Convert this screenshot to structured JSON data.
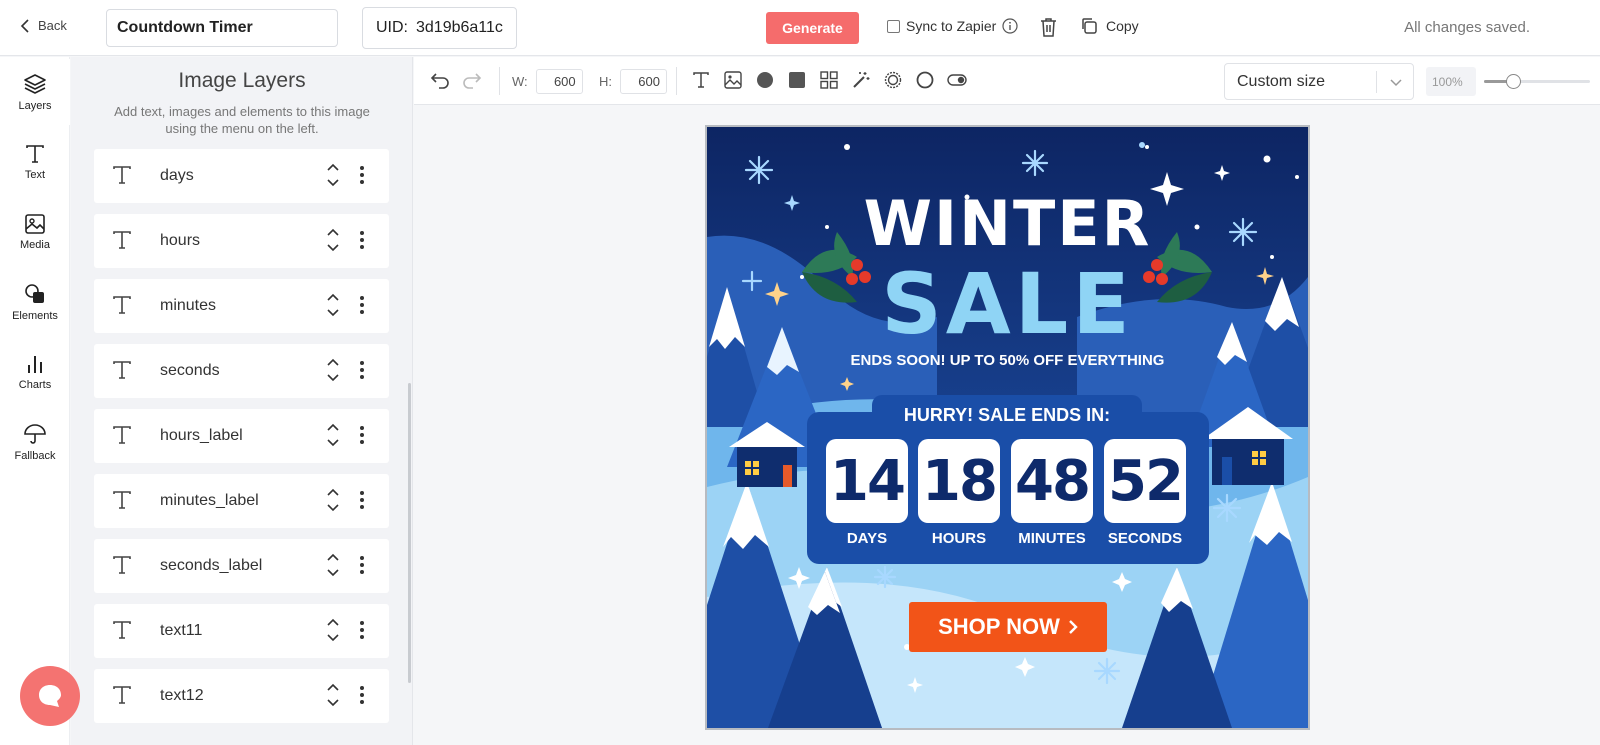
{
  "header": {
    "back_label": "Back",
    "name_value": "Countdown Timer",
    "uid_label": "UID:",
    "uid_value": "3d19b6a11c",
    "generate_label": "Generate",
    "sync_label": "Sync to Zapier",
    "copy_label": "Copy",
    "status": "All changes saved."
  },
  "rail": [
    {
      "label": "Layers",
      "icon": "layers-icon"
    },
    {
      "label": "Text",
      "icon": "text-icon"
    },
    {
      "label": "Media",
      "icon": "image-icon"
    },
    {
      "label": "Elements",
      "icon": "shapes-icon"
    },
    {
      "label": "Charts",
      "icon": "bar-chart-icon"
    },
    {
      "label": "Fallback",
      "icon": "umbrella-icon"
    }
  ],
  "panel": {
    "title": "Image Layers",
    "subtitle": "Add text, images and elements to this image using the menu on the left.",
    "layers": [
      "days",
      "hours",
      "minutes",
      "seconds",
      "hours_label",
      "minutes_label",
      "seconds_label",
      "text11",
      "text12"
    ]
  },
  "toolbar": {
    "w_label": "W:",
    "w_value": "600",
    "h_label": "H:",
    "h_value": "600",
    "size_option": "Custom size",
    "zoom": "100%",
    "zoom_level": 0.27
  },
  "canvas": {
    "title_line1": "WINTER",
    "title_line2": "SALE",
    "subline": "ENDS SOON! UP TO 50% OFF EVERYTHING",
    "hurry": "HURRY! SALE ENDS IN:",
    "countdown": [
      {
        "value": "14",
        "label": "DAYS"
      },
      {
        "value": "18",
        "label": "HOURS"
      },
      {
        "value": "48",
        "label": "MINUTES"
      },
      {
        "value": "52",
        "label": "SECONDS"
      }
    ],
    "cta": "SHOP NOW",
    "colors": {
      "sky": "#0f2d6e",
      "accent_blue": "#8fd4f5",
      "cta": "#f25418",
      "brand_red": "#f56c6c"
    }
  }
}
